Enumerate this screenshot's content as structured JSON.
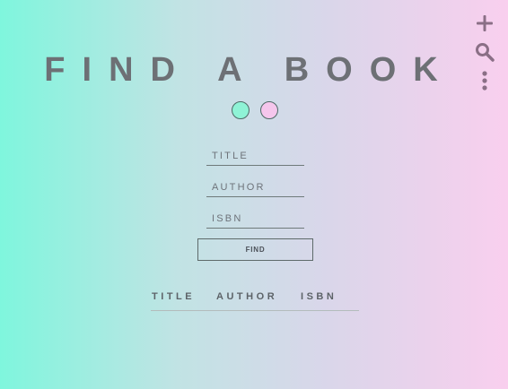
{
  "header": {
    "title": "FIND A BOOK"
  },
  "toolbar": {
    "items": [
      {
        "icon": "plus-icon"
      },
      {
        "icon": "search-icon"
      },
      {
        "icon": "more-vertical-icon"
      }
    ],
    "icon_color": "#8a6f86"
  },
  "theme_swatches": [
    {
      "color": "#8ff3d6"
    },
    {
      "color": "#f5c6ec"
    }
  ],
  "search_form": {
    "title_placeholder": "TITLE",
    "author_placeholder": "AUTHOR",
    "isbn_placeholder": "ISBN",
    "title_value": "",
    "author_value": "",
    "isbn_value": "",
    "find_label": "FIND"
  },
  "results": {
    "columns": [
      "TITLE",
      "AUTHOR",
      "ISBN"
    ],
    "rows": []
  },
  "colors": {
    "gradient_left": "#7ff6dd",
    "gradient_right": "#f9cfee",
    "text": "#6d7075"
  }
}
